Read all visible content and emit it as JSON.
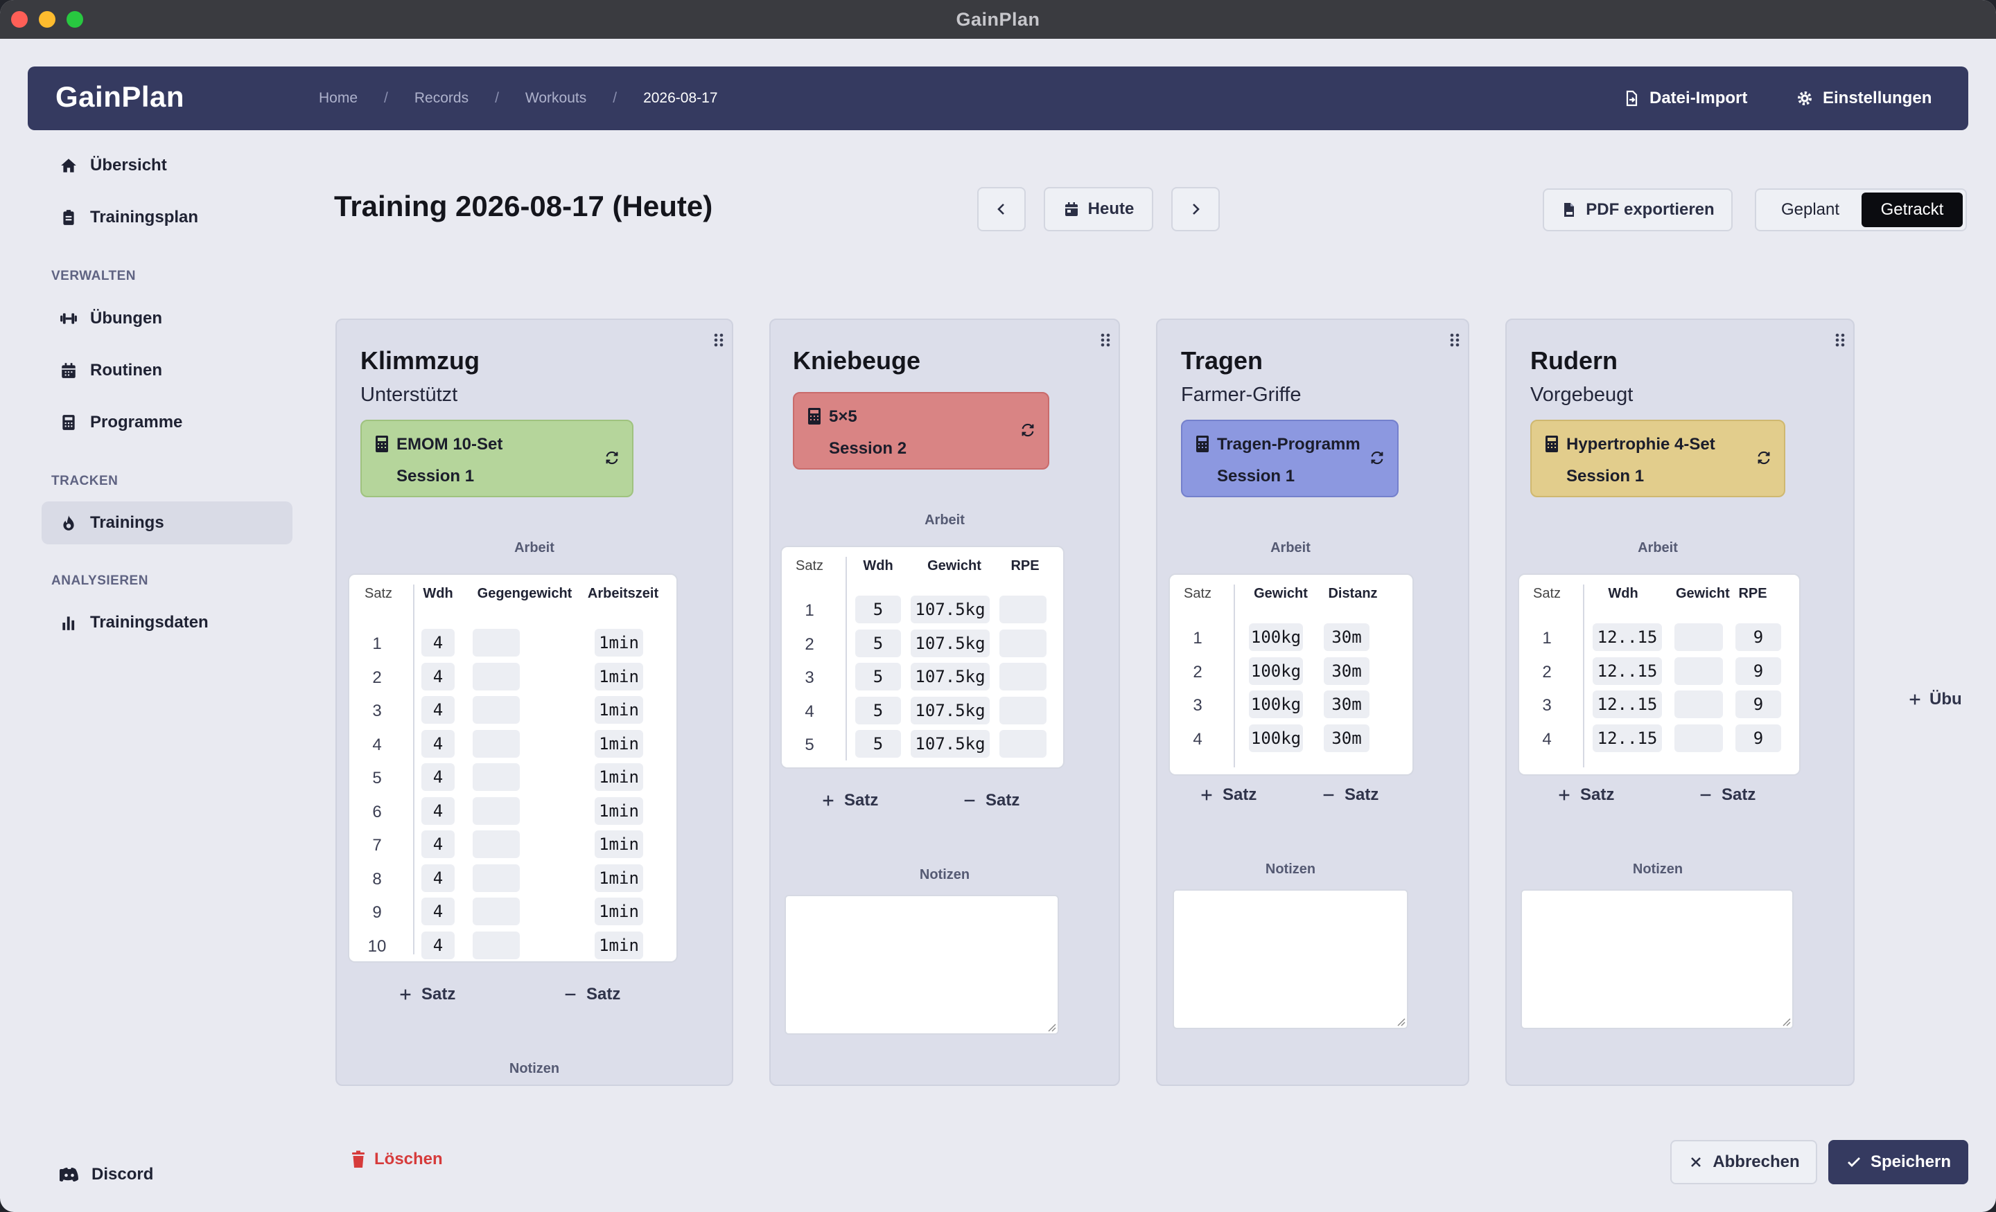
{
  "window": {
    "title": "GainPlan"
  },
  "topnav": {
    "brand": "GainPlan",
    "breadcrumbs": [
      "Home",
      "Records",
      "Workouts",
      "2026-08-17"
    ],
    "separator": "/",
    "import_label": "Datei-Import",
    "settings_label": "Einstellungen"
  },
  "sidebar": {
    "overview": "Übersicht",
    "training_plan": "Trainingsplan",
    "section_manage": "VERWALTEN",
    "exercises": "Übungen",
    "routines": "Routinen",
    "programs": "Programme",
    "section_track": "TRACKEN",
    "trainings": "Trainings",
    "section_analyze": "ANALYSIEREN",
    "training_data": "Trainingsdaten",
    "discord": "Discord"
  },
  "header": {
    "title": "Training 2026-08-17 (Heute)",
    "today_label": "Heute",
    "pdf_label": "PDF exportieren",
    "mode_planned": "Geplant",
    "mode_tracked": "Getrackt",
    "active_mode": "Getrackt"
  },
  "colors": {
    "nav_bg": "#353a60",
    "routine_green": "#b5d59b",
    "routine_red": "#d98484",
    "routine_blue": "#8c98e0",
    "routine_yellow": "#e2cd8c",
    "delete_red": "#d63b3b",
    "save_bg": "#353a60"
  },
  "labels": {
    "work": "Arbeit",
    "notes": "Notizen",
    "add_set": "Satz",
    "remove_set": "Satz"
  },
  "exercises": [
    {
      "name": "Klimmzug",
      "variant": "Unterstützt",
      "routine": {
        "name": "EMOM 10-Set",
        "session": "Session 1"
      },
      "columns": [
        "Satz",
        "Wdh",
        "Gegengewicht",
        "Arbeitszeit"
      ],
      "rows": [
        [
          "1",
          "4",
          "",
          "1min"
        ],
        [
          "2",
          "4",
          "",
          "1min"
        ],
        [
          "3",
          "4",
          "",
          "1min"
        ],
        [
          "4",
          "4",
          "",
          "1min"
        ],
        [
          "5",
          "4",
          "",
          "1min"
        ],
        [
          "6",
          "4",
          "",
          "1min"
        ],
        [
          "7",
          "4",
          "",
          "1min"
        ],
        [
          "8",
          "4",
          "",
          "1min"
        ],
        [
          "9",
          "4",
          "",
          "1min"
        ],
        [
          "10",
          "4",
          "",
          "1min"
        ]
      ]
    },
    {
      "name": "Kniebeuge",
      "variant": "",
      "routine": {
        "name": "5×5",
        "session": "Session 2"
      },
      "columns": [
        "Satz",
        "Wdh",
        "Gewicht",
        "RPE"
      ],
      "rows": [
        [
          "1",
          "5",
          "107.5kg",
          ""
        ],
        [
          "2",
          "5",
          "107.5kg",
          ""
        ],
        [
          "3",
          "5",
          "107.5kg",
          ""
        ],
        [
          "4",
          "5",
          "107.5kg",
          ""
        ],
        [
          "5",
          "5",
          "107.5kg",
          ""
        ]
      ]
    },
    {
      "name": "Tragen",
      "variant": "Farmer-Griffe",
      "routine": {
        "name": "Tragen-Programm",
        "session": "Session 1"
      },
      "columns": [
        "Satz",
        "Gewicht",
        "Distanz"
      ],
      "rows": [
        [
          "1",
          "100kg",
          "30m"
        ],
        [
          "2",
          "100kg",
          "30m"
        ],
        [
          "3",
          "100kg",
          "30m"
        ],
        [
          "4",
          "100kg",
          "30m"
        ]
      ]
    },
    {
      "name": "Rudern",
      "variant": "Vorgebeugt",
      "routine": {
        "name": "Hypertrophie 4-Set",
        "session": "Session 1"
      },
      "columns": [
        "Satz",
        "Wdh",
        "Gewicht",
        "RPE"
      ],
      "rows": [
        [
          "1",
          "12..15",
          "",
          "9"
        ],
        [
          "2",
          "12..15",
          "",
          "9"
        ],
        [
          "3",
          "12..15",
          "",
          "9"
        ],
        [
          "4",
          "12..15",
          "",
          "9"
        ]
      ]
    }
  ],
  "add_exercise_label": "Übu",
  "footer": {
    "delete_label": "Löschen",
    "cancel_label": "Abbrechen",
    "save_label": "Speichern"
  }
}
